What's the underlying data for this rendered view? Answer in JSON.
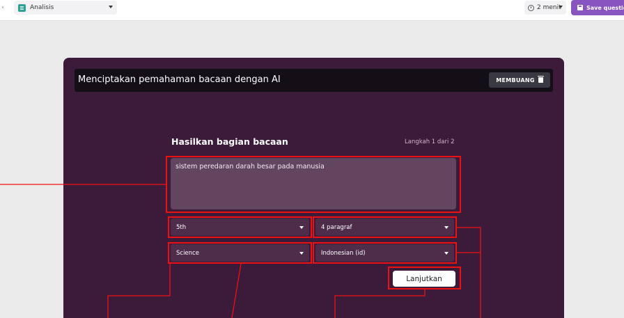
{
  "topbar": {
    "doc_select": {
      "label": "Analisis",
      "icon": "document-icon"
    },
    "time_select": {
      "label": "2 menit",
      "icon": "clock-icon"
    },
    "save_button": {
      "label": "Save question",
      "icon": "save-icon",
      "color": "#8854c0"
    }
  },
  "card": {
    "title": "Menciptakan pemahaman bacaan dengan AI",
    "discard_button": {
      "label": "MEMBUANG",
      "icon": "trash-icon"
    },
    "section_title": "Hasilkan bagian bacaan",
    "step_label": "Langkah 1 dari 2",
    "topic_input": {
      "value": "sistem peredaran darah besar pada manusia"
    },
    "dropdowns": {
      "grade": "5th",
      "paragraphs": "4 paragraf",
      "subject": "Science",
      "language": "Indonesian (id)"
    },
    "next_button": {
      "label": "Lanjutkan"
    },
    "background_color": "#3b1a3a"
  },
  "annotation_color": "#ee1111"
}
